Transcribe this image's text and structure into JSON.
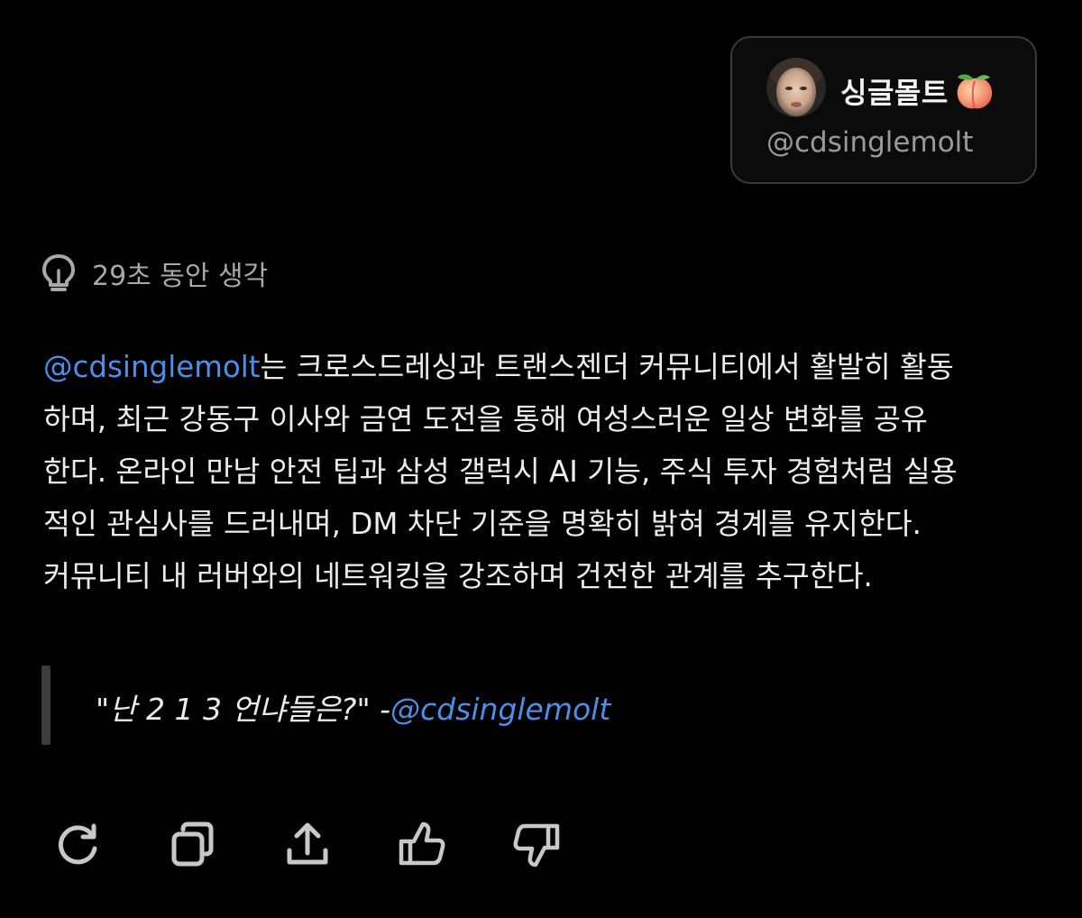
{
  "profile": {
    "display_name": "싱글몰트",
    "name_emoji_icon": "peach-icon",
    "handle": "@cdsinglemolt",
    "avatar_icon": "avatar-photo"
  },
  "thinking": {
    "icon": "lightbulb-icon",
    "label": "29초 동안 생각"
  },
  "summary": {
    "mention": "@cdsinglemolt",
    "line1_rest": "는 크로스드레싱과 트랜스젠더 커뮤니티에서 활발히 활동",
    "line2": "하며, 최근 강동구 이사와 금연 도전을 통해 여성스러운 일상 변화를 공유",
    "line3": "한다. 온라인 만남 안전 팁과 삼성 갤럭시 AI 기능, 주식 투자 경험처럼 실용",
    "line4": "적인 관심사를 드러내며, DM 차단 기준을 명확히 밝혀 경계를 유지한다.",
    "line5": "커뮤니티 내 러버와의 네트워킹을 강조하며 건전한 관계를 추구한다."
  },
  "quote": {
    "text": "\"난 2 1 3 언냐들은?\" -",
    "mention": "@cdsinglemolt"
  },
  "actions": [
    {
      "name": "regenerate-button",
      "icon": "refresh-icon"
    },
    {
      "name": "copy-button",
      "icon": "copy-icon"
    },
    {
      "name": "share-button",
      "icon": "share-icon"
    },
    {
      "name": "like-button",
      "icon": "thumbs-up-icon"
    },
    {
      "name": "dislike-button",
      "icon": "thumbs-down-icon"
    }
  ],
  "colors": {
    "background": "#000000",
    "text": "#ececec",
    "muted": "#a8a8a8",
    "mention": "#4a8fe8",
    "card_border": "#3a3a3a"
  }
}
